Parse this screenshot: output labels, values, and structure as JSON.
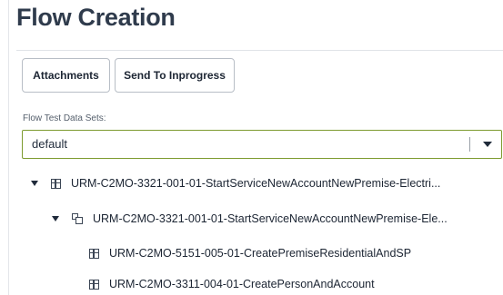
{
  "header": {
    "title": "Flow Creation"
  },
  "toolbar": {
    "attachments_label": "Attachments",
    "send_label": "Send To Inprogress"
  },
  "test_data": {
    "label": "Flow Test Data Sets:",
    "selected": "default"
  },
  "tree": {
    "items": [
      {
        "label": "URM-C2MO-3321-001-01-StartServiceNewAccountNewPremise-Electri...",
        "icon": "grid-icon",
        "expanded": true
      },
      {
        "label": "URM-C2MO-3321-001-01-StartServiceNewAccountNewPremise-Ele...",
        "icon": "copy-icon",
        "expanded": true
      },
      {
        "label": "URM-C2MO-5151-005-01-CreatePremiseResidentialAndSP",
        "icon": "grid-icon"
      },
      {
        "label": "URM-C2MO-3311-004-01-CreatePersonAndAccount",
        "icon": "grid-icon"
      }
    ]
  }
}
